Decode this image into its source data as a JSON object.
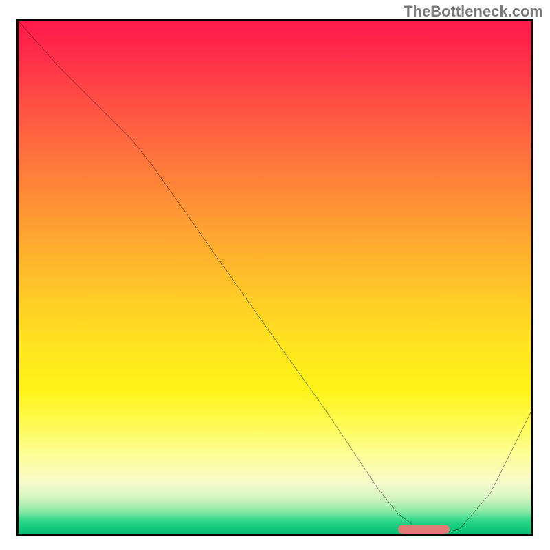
{
  "watermark": "TheBottleneck.com",
  "chart_data": {
    "type": "line",
    "title": "",
    "xlabel": "",
    "ylabel": "",
    "xlim": [
      0,
      100
    ],
    "ylim": [
      0,
      100
    ],
    "grid": false,
    "legend": false,
    "background": "gradient-red-to-green",
    "series": [
      {
        "name": "bottleneck-curve",
        "color": "#000000",
        "x": [
          0,
          8,
          18,
          22,
          26,
          38,
          50,
          60,
          66,
          70,
          74,
          78,
          82,
          86,
          92,
          100
        ],
        "y": [
          100,
          91,
          81,
          77,
          72,
          55,
          38,
          24,
          15,
          9,
          4,
          1,
          0,
          1,
          8,
          24
        ]
      }
    ],
    "annotations": [
      {
        "name": "target-marker",
        "type": "pill",
        "color": "#e27a78",
        "x_start": 74,
        "x_end": 84,
        "y": 0.5
      }
    ]
  }
}
